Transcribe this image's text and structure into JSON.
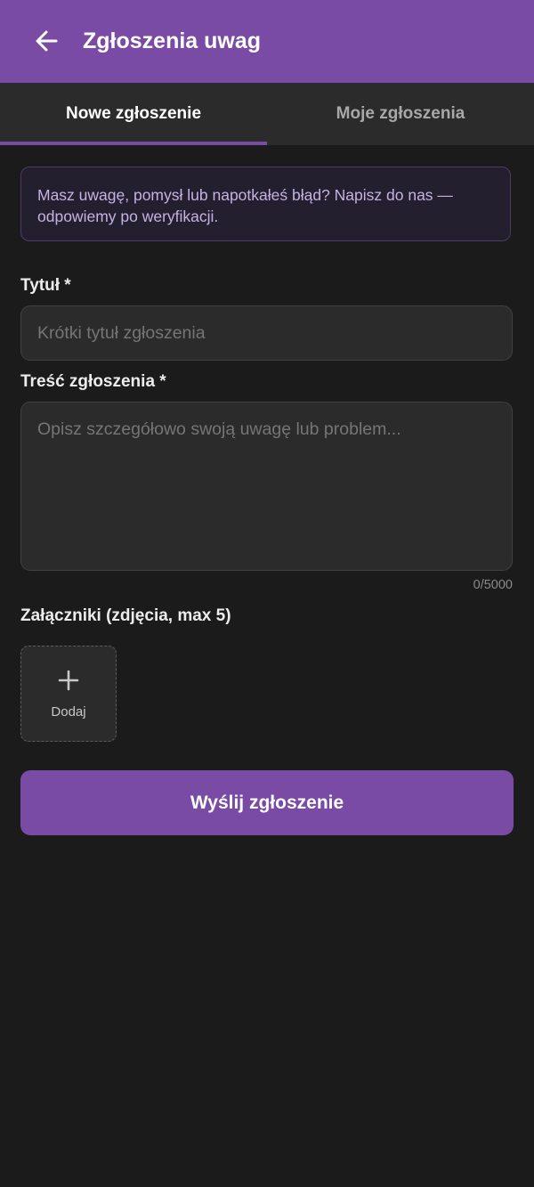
{
  "appbar": {
    "title": "Zgłoszenia uwag",
    "back_icon": "arrow-left-icon",
    "color": "#7a4ba5"
  },
  "tabs": [
    {
      "label": "Nowe zgłoszenie",
      "active": true
    },
    {
      "label": "Moje zgłoszenia",
      "active": false
    }
  ],
  "info": {
    "text": "Masz uwagę, pomysł lub napotkałeś błąd? Napisz do nas — odpowiemy po weryfikacji."
  },
  "form": {
    "title_label": "Tytuł *",
    "title_placeholder": "Krótki tytuł zgłoszenia",
    "title_value": "",
    "body_label": "Treść zgłoszenia *",
    "body_placeholder": "Opisz szczegółowo swoją uwagę lub problem...",
    "body_value": "",
    "counter": "0/5000",
    "attachments_label": "Załączniki (zdjęcia, max 5)",
    "add_label": "Dodaj",
    "add_icon": "plus-icon"
  },
  "submit": {
    "label": "Wyślij zgłoszenie"
  },
  "colors": {
    "accent": "#7a4ba5",
    "background": "#1b1b1b",
    "surface": "#2b2b2b",
    "info_text": "#c5b2e3"
  }
}
